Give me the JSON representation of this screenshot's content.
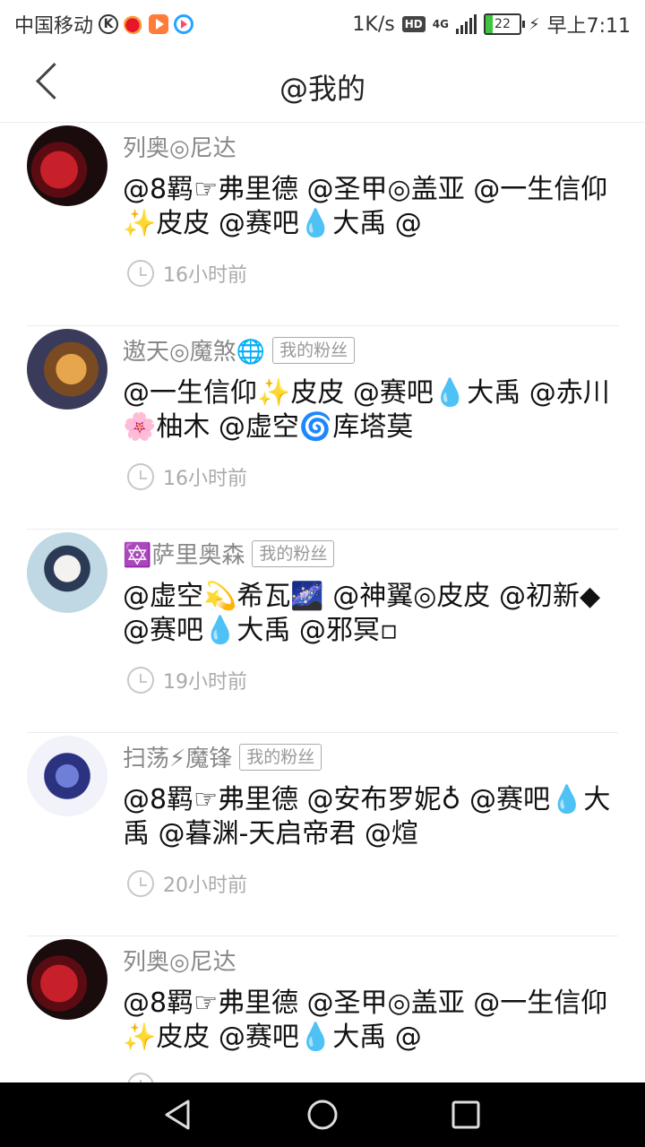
{
  "status_bar": {
    "carrier": "中国移动",
    "speed": "1K/s",
    "hd": "HD",
    "network": "4G",
    "battery": "22",
    "time": "早上7:11"
  },
  "header": {
    "title": "@我的"
  },
  "feed": [
    {
      "username": "列奥◎尼达",
      "badge": "",
      "content": " @8羁☞弗里德 @圣甲◎盖亚 @一生信仰✨皮皮 @赛吧💧大禹 @",
      "time": "16小时前"
    },
    {
      "username": "遨天◎魔煞🌐",
      "badge": "我的粉丝",
      "content": " @一生信仰✨皮皮 @赛吧💧大禹 @赤川🌸柚木 @虚空🌀库塔莫",
      "time": "16小时前"
    },
    {
      "username": "🔯萨里奥森",
      "badge": "我的粉丝",
      "content": " @虚空💫希瓦🌌 @神翼◎皮皮 @初新◆ @赛吧💧大禹 @邪冥▫",
      "time": "19小时前"
    },
    {
      "username": "扫荡⚡魔锋",
      "badge": "我的粉丝",
      "content": " @8羁☞弗里德 @安布罗妮♁ @赛吧💧大禹 @暮渊-天启帝君 @煊",
      "time": "20小时前"
    },
    {
      "username": "列奥◎尼达",
      "badge": "",
      "content": " @8羁☞弗里德 @圣甲◎盖亚 @一生信仰✨皮皮 @赛吧💧大禹 @",
      "time": ""
    }
  ]
}
